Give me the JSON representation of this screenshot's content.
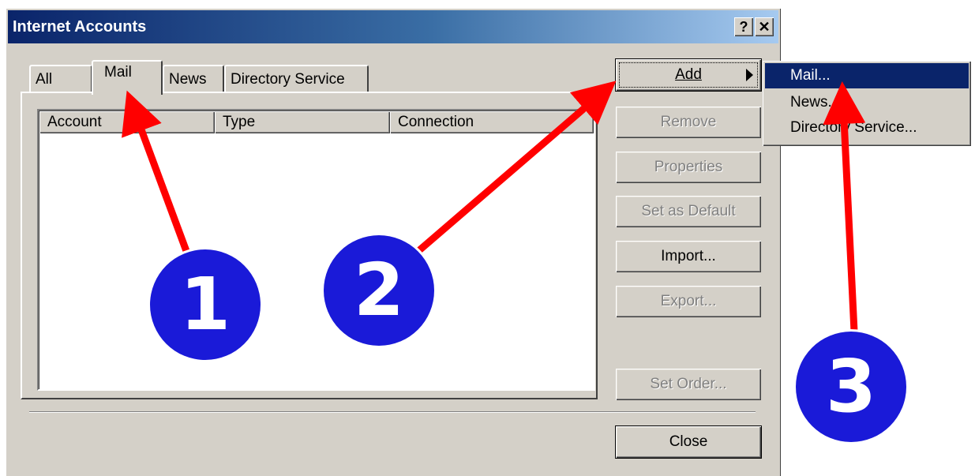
{
  "window": {
    "title": "Internet Accounts",
    "help_glyph": "?",
    "close_glyph": "✕"
  },
  "tabs": [
    {
      "label": "All"
    },
    {
      "label": "Mail"
    },
    {
      "label": "News"
    },
    {
      "label": "Directory Service"
    }
  ],
  "active_tab": "Mail",
  "list": {
    "columns": [
      "Account",
      "Type",
      "Connection"
    ],
    "rows": []
  },
  "buttons": {
    "add": "Add",
    "remove": "Remove",
    "properties": "Properties",
    "set_default": "Set as Default",
    "import": "Import...",
    "export": "Export...",
    "set_order": "Set Order...",
    "close": "Close"
  },
  "add_menu": {
    "items": [
      "Mail...",
      "News...",
      "Directory Service..."
    ],
    "highlighted": "Mail..."
  },
  "annotations": {
    "badges": [
      "1",
      "2",
      "3"
    ],
    "arrow_color": "#ff0000",
    "badge_color": "#1a1ad8"
  }
}
